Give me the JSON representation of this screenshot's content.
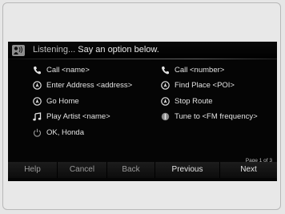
{
  "header": {
    "status": "Listening...",
    "prompt": "Say an option below.",
    "icon": "voice-command-icon"
  },
  "options": [
    {
      "label": "Call <name>",
      "icon": "phone-icon"
    },
    {
      "label": "Call <number>",
      "icon": "phone-icon"
    },
    {
      "label": "Enter Address <address>",
      "icon": "navigation-icon"
    },
    {
      "label": "Find Place <POI>",
      "icon": "navigation-icon"
    },
    {
      "label": "Go Home",
      "icon": "navigation-icon"
    },
    {
      "label": "Stop Route",
      "icon": "navigation-icon"
    },
    {
      "label": "Play Artist <name>",
      "icon": "music-note-icon"
    },
    {
      "label": "Tune to <FM frequency>",
      "icon": "radio-tuner-icon"
    },
    {
      "label": "OK, Honda",
      "icon": "power-icon"
    }
  ],
  "page_indicator": "Page 1 of 3",
  "buttons": {
    "help": "Help",
    "cancel": "Cancel",
    "back": "Back",
    "previous": "Previous",
    "next": "Next"
  },
  "colors": {
    "screen_bg": "#050505",
    "text": "#e2e2e2",
    "button_disabled_text": "#9a9a9a"
  }
}
